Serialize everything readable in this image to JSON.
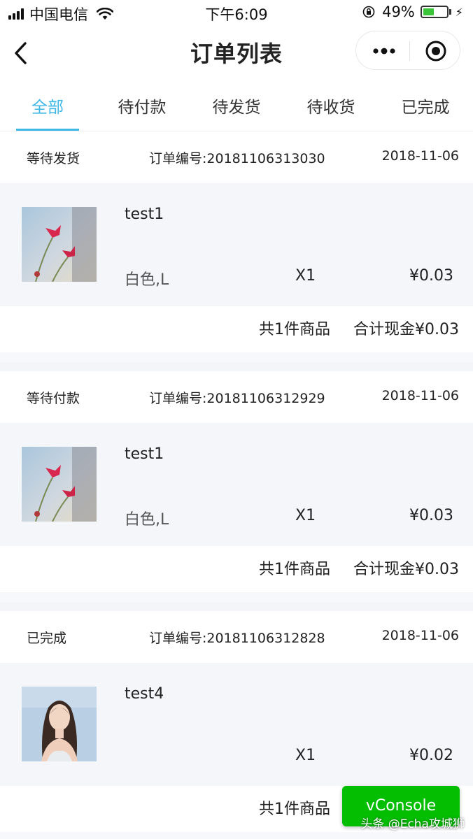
{
  "status_bar": {
    "carrier": "中国电信",
    "time": "下午6:09",
    "battery_percent": "49%",
    "battery_level": 0.49
  },
  "nav": {
    "title": "订单列表"
  },
  "tabs": [
    {
      "label": "全部",
      "active": true
    },
    {
      "label": "待付款",
      "active": false
    },
    {
      "label": "待发货",
      "active": false
    },
    {
      "label": "待收货",
      "active": false
    },
    {
      "label": "已完成",
      "active": false
    }
  ],
  "orders": [
    {
      "status": "等待发货",
      "number": "订单编号:20181106313030",
      "date": "2018-11-06",
      "item": {
        "name": "test1",
        "spec": "白色,L",
        "qty": "X1",
        "price": "¥0.03",
        "image": "flower-image"
      },
      "count_text": "共1件商品",
      "total_text": "合计现金¥0.03"
    },
    {
      "status": "等待付款",
      "number": "订单编号:20181106312929",
      "date": "2018-11-06",
      "item": {
        "name": "test1",
        "spec": "白色,L",
        "qty": "X1",
        "price": "¥0.03",
        "image": "flower-image"
      },
      "count_text": "共1件商品",
      "total_text": "合计现金¥0.03"
    },
    {
      "status": "已完成",
      "number": "订单编号:20181106312828",
      "date": "2018-11-06",
      "item": {
        "name": "test4",
        "spec": "",
        "qty": "X1",
        "price": "¥0.02",
        "image": "person-photo"
      },
      "count_text": "共1件商品",
      "total_text": ""
    }
  ],
  "vconsole_label": "vConsole",
  "watermark": "头条 @Echa攻城狮",
  "colors": {
    "accent": "#3fb7e6",
    "vconsole_green": "#04be02",
    "battery_green": "#3ac43a"
  }
}
